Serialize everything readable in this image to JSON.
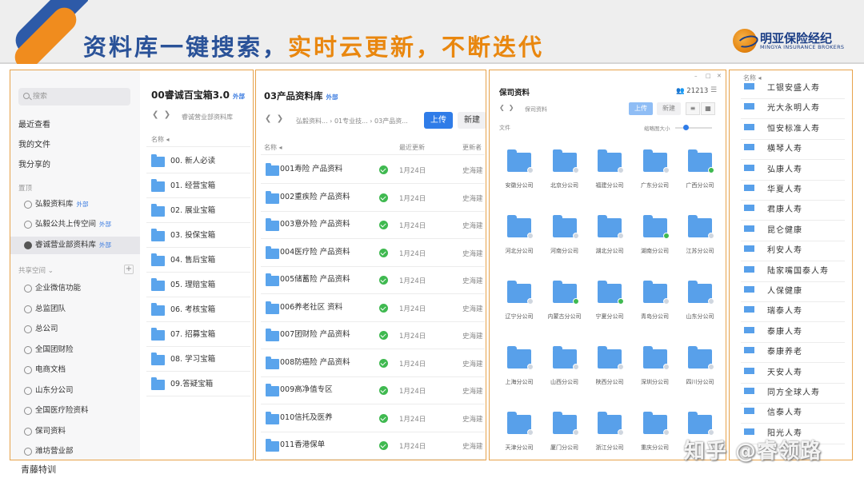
{
  "header": {
    "slogan_part1": "资料库一键搜索，",
    "slogan_part2": "实时云更新，不断迭代",
    "logo_cn": "明亚保险经纪",
    "logo_en": "MINGYA INSURANCE BROKERS",
    "colors": {
      "blue": "#2a5298",
      "orange": "#e9870f"
    }
  },
  "panel1": {
    "search_placeholder": "搜索",
    "nav": [
      "最近查看",
      "我的文件",
      "我分享的"
    ],
    "pinned_label": "置顶",
    "pinned": [
      {
        "label": "弘毅资料库",
        "tag": "外部"
      },
      {
        "label": "弘毅公共上传空间",
        "tag": "外部"
      },
      {
        "label": "睿诚营业部资料库",
        "tag": "外部"
      }
    ],
    "shared_label": "共享空间",
    "shared": [
      "企业微信功能",
      "总监团队",
      "总公司",
      "全国团财险",
      "电商文档",
      "山东分公司",
      "全国医疗险资料",
      "保司资料",
      "潍坊营业部"
    ],
    "title": "00睿诚百宝箱3.0",
    "title_tag": "外部",
    "breadcrumb": "睿诚营业部资料库",
    "col_name": "名称",
    "folders": [
      "00. 新人必读",
      "01. 经营宝箱",
      "02. 展业宝箱",
      "03. 投保宝箱",
      "04. 售后宝箱",
      "05. 理赔宝箱",
      "06. 考核宝箱",
      "07. 招募宝箱",
      "08. 学习宝箱",
      "09.答疑宝箱"
    ]
  },
  "panel2": {
    "title": "03产品资料库",
    "title_tag": "外部",
    "breadcrumb": [
      "弘毅资料...",
      "01专业技...",
      "03产品资..."
    ],
    "upload": "上传",
    "new": "新建",
    "col_name": "名称",
    "col_updated": "最近更新",
    "col_updater": "更新者",
    "rows": [
      {
        "name": "001寿险 产品资料",
        "date": "1月24日",
        "user": "史海建"
      },
      {
        "name": "002重疾险 产品资料",
        "date": "1月24日",
        "user": "史海建"
      },
      {
        "name": "003意外险 产品资料",
        "date": "1月24日",
        "user": "史海建"
      },
      {
        "name": "004医疗险 产品资料",
        "date": "1月24日",
        "user": "史海建"
      },
      {
        "name": "005储蓄险 产品资料",
        "date": "1月24日",
        "user": "史海建"
      },
      {
        "name": "006养老社区 资料",
        "date": "1月24日",
        "user": "史海建"
      },
      {
        "name": "007团财险 产品资料",
        "date": "1月24日",
        "user": "史海建"
      },
      {
        "name": "008防癌险 产品资料",
        "date": "1月24日",
        "user": "史海建"
      },
      {
        "name": "009高净值专区",
        "date": "1月24日",
        "user": "史海建"
      },
      {
        "name": "010信托及医养",
        "date": "1月24日",
        "user": "史海建"
      },
      {
        "name": "011香港保单",
        "date": "1月24日",
        "user": "史海建"
      }
    ]
  },
  "panel3": {
    "title": "保司资料",
    "members": "21213",
    "breadcrumb": "保司资料",
    "upload": "上传",
    "new": "新建",
    "files_label": "文件",
    "size_label": "缩略图大小",
    "folders": [
      {
        "name": "安徽分公司",
        "ok": false
      },
      {
        "name": "北京分公司",
        "ok": false
      },
      {
        "name": "福建分公司",
        "ok": false
      },
      {
        "name": "广东分公司",
        "ok": false
      },
      {
        "name": "广西分公司",
        "ok": true
      },
      {
        "name": "河北分公司",
        "ok": false
      },
      {
        "name": "河南分公司",
        "ok": false
      },
      {
        "name": "湖北分公司",
        "ok": false
      },
      {
        "name": "湖南分公司",
        "ok": true
      },
      {
        "name": "江苏分公司",
        "ok": false
      },
      {
        "name": "辽宁分公司",
        "ok": false
      },
      {
        "name": "内蒙古分公司",
        "ok": true
      },
      {
        "name": "宁夏分公司",
        "ok": true
      },
      {
        "name": "青岛分公司",
        "ok": false
      },
      {
        "name": "山东分公司",
        "ok": false
      },
      {
        "name": "上海分公司",
        "ok": false
      },
      {
        "name": "山西分公司",
        "ok": false
      },
      {
        "name": "陕西分公司",
        "ok": false
      },
      {
        "name": "深圳分公司",
        "ok": false
      },
      {
        "name": "四川分公司",
        "ok": false
      },
      {
        "name": "天津分公司",
        "ok": false
      },
      {
        "name": "厦门分公司",
        "ok": false
      },
      {
        "name": "浙江分公司",
        "ok": false
      },
      {
        "name": "重庆分公司",
        "ok": false
      },
      {
        "name": "",
        "ok": false
      }
    ]
  },
  "panel4": {
    "col_name": "名称",
    "companies": [
      "工银安盛人寿",
      "光大永明人寿",
      "恒安标准人寿",
      "横琴人寿",
      "弘康人寿",
      "华夏人寿",
      "君康人寿",
      "昆仑健康",
      "利安人寿",
      "陆家嘴国泰人寿",
      "人保健康",
      "瑞泰人寿",
      "泰康人寿",
      "泰康养老",
      "天安人寿",
      "同方全球人寿",
      "信泰人寿",
      "阳光人寿"
    ]
  },
  "footer": "青藤特训",
  "watermark": "知乎 @睿领路"
}
